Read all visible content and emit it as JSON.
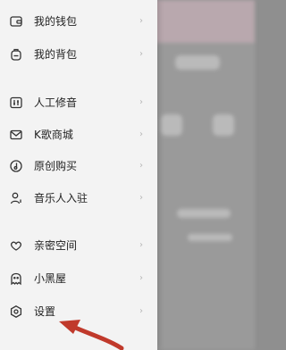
{
  "drawer": {
    "items": [
      {
        "label": "我的钱包",
        "icon": "wallet-icon",
        "chevron": "›"
      },
      {
        "label": "我的背包",
        "icon": "backpack-icon",
        "chevron": "›"
      },
      {
        "label": "人工修音",
        "icon": "equalizer-icon",
        "chevron": "›"
      },
      {
        "label": "K歌商城",
        "icon": "mail-icon",
        "chevron": "›"
      },
      {
        "label": "原创购买",
        "icon": "music-disc-icon",
        "chevron": "›"
      },
      {
        "label": "音乐人入驻",
        "icon": "musician-icon",
        "chevron": "›"
      },
      {
        "label": "亲密空间",
        "icon": "heart-link-icon",
        "chevron": "›"
      },
      {
        "label": "小黑屋",
        "icon": "ghost-icon",
        "chevron": "›"
      },
      {
        "label": "设置",
        "icon": "settings-icon",
        "chevron": "›"
      }
    ]
  },
  "annotation": {
    "arrow_color": "#c0392b"
  }
}
